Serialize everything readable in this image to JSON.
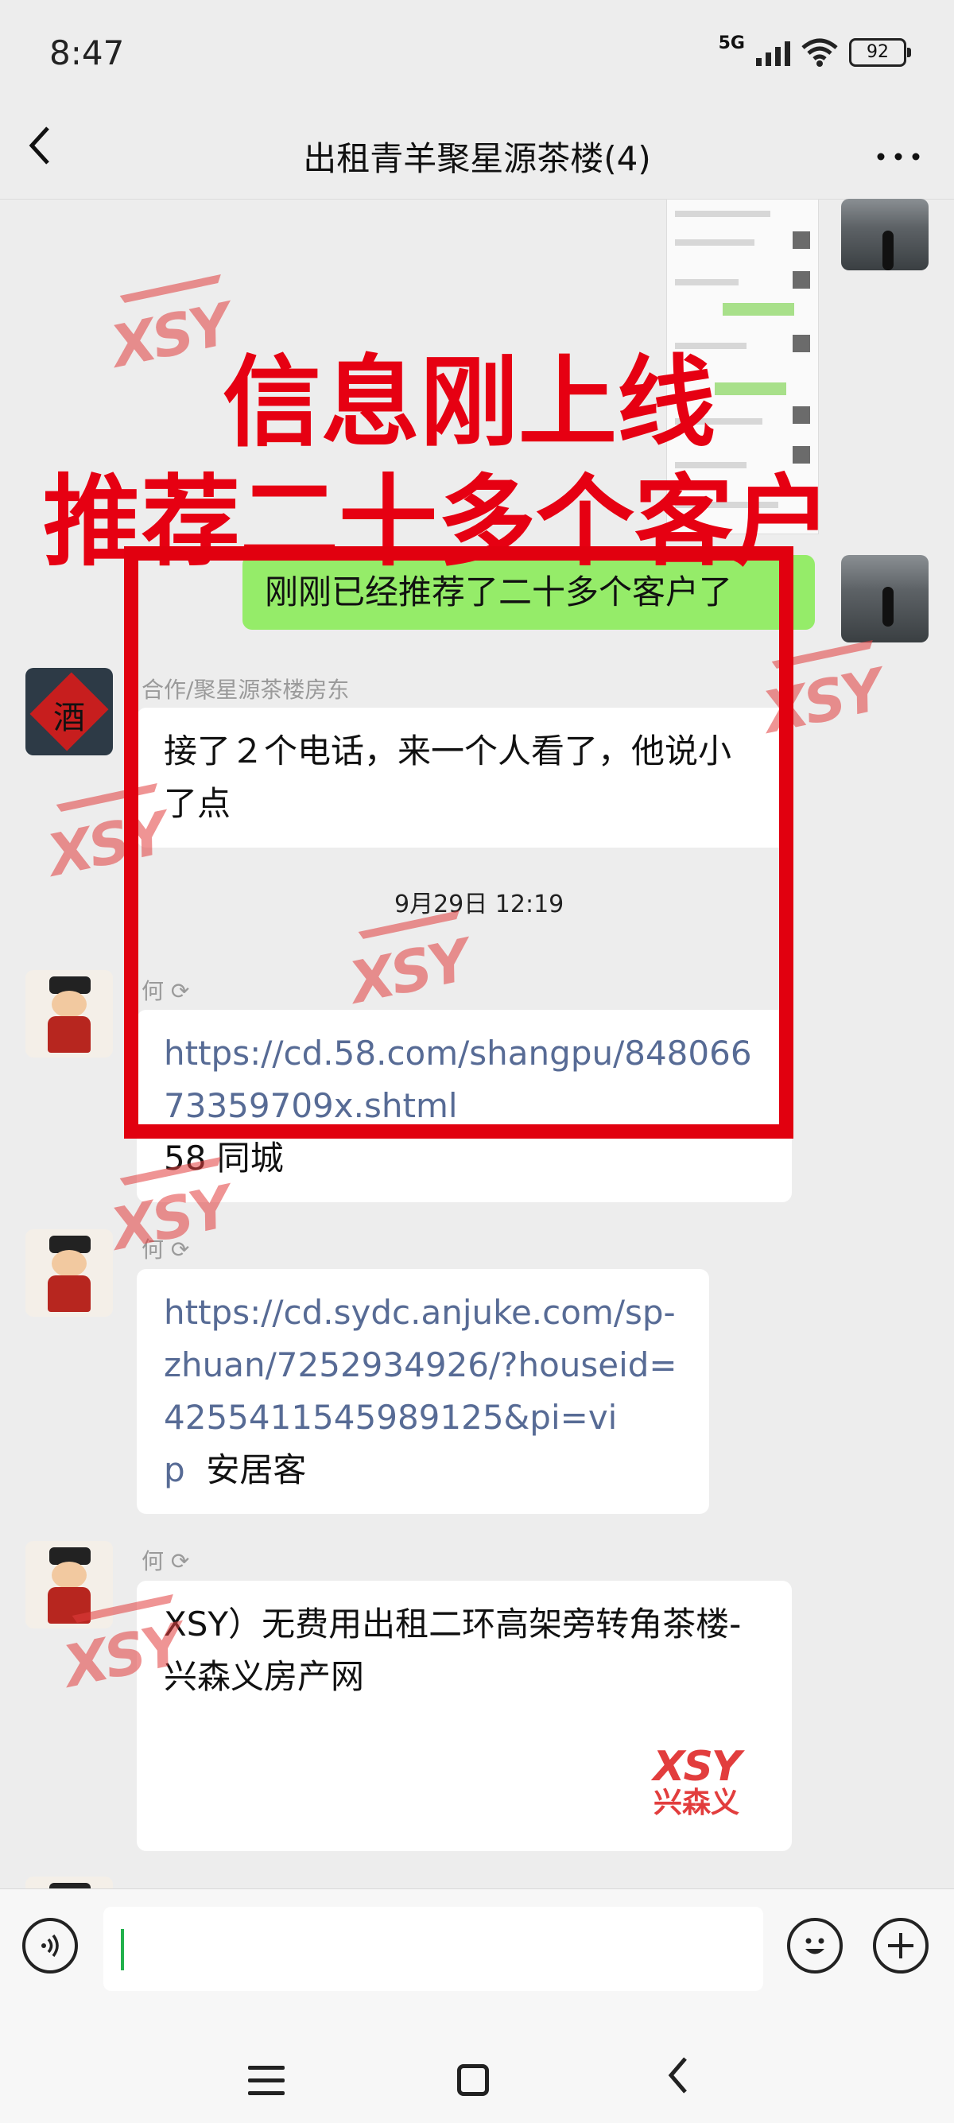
{
  "status_bar": {
    "time": "8:47",
    "network": "5G",
    "battery": "92"
  },
  "header": {
    "title": "出租青羊聚星源茶楼(4)",
    "back_icon": "back-arrow-icon",
    "more_icon": "more-dots-icon"
  },
  "overlay": {
    "line1": "信息刚上线",
    "line2": "推荐二十多个客户",
    "color": "#e60012"
  },
  "messages": [
    {
      "sender": "",
      "self": true,
      "text": "刚刚已经推荐了二十多个客户了"
    },
    {
      "sender": "合作/聚星源茶楼房东",
      "self": false,
      "text": "接了２个电话，来一个人看了，他说小了点"
    },
    {
      "sender": "何",
      "self": false,
      "link": "https://cd.58.com/shangpu/84806673359709x.shtml",
      "suffix": "58 同城"
    },
    {
      "sender": "何",
      "self": false,
      "link": "https://cd.sydc.anjuke.com/sp-zhuan/7252934926/?houseid=4255411545989125&pi=vip",
      "suffix": "安居客"
    },
    {
      "sender": "何",
      "self": false,
      "text": "XSY）无费用出租二环高架旁转角茶楼-兴森义房产网",
      "logo_text": "XSY",
      "logo_cn": "兴森义"
    }
  ],
  "timestamp": "9月29日 12:19",
  "link_color": "#576b95",
  "self_bubble_color": "#95ec69",
  "watermark_text": "XSY",
  "input_bar": {
    "voice_icon": "voice-icon",
    "emoji_icon": "emoji-icon",
    "plus_icon": "plus-icon"
  }
}
